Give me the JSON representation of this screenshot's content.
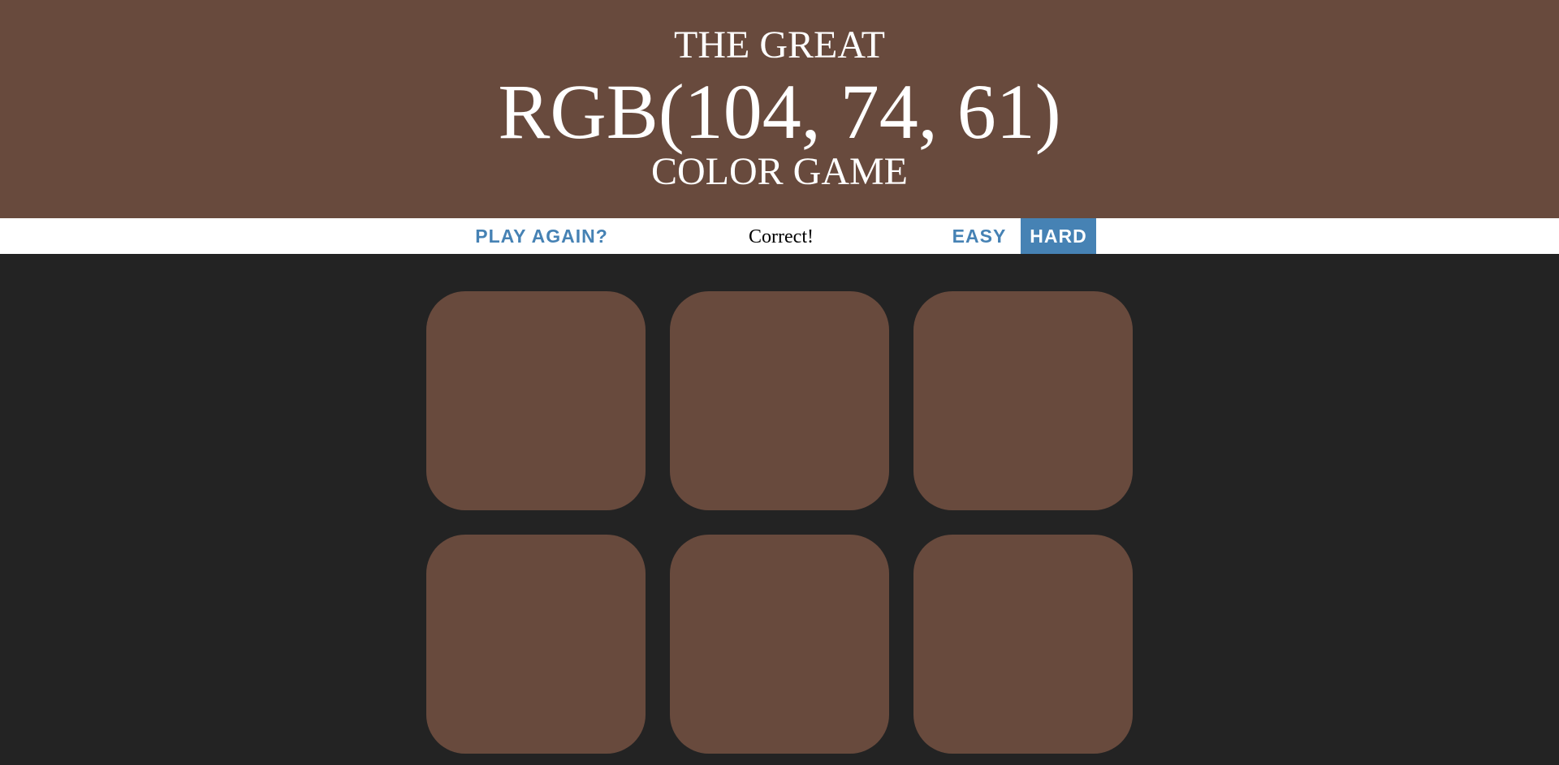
{
  "header": {
    "line1": "THE GREAT",
    "rgb_display": "RGB(104, 74, 61)",
    "line3": "COLOR GAME",
    "background_color": "#684a3d"
  },
  "controls": {
    "reset_label": "PLAY AGAIN?",
    "message": "Correct!",
    "easy_label": "EASY",
    "hard_label": "HARD",
    "selected_mode": "HARD",
    "accent_color": "#4682b4"
  },
  "squares": [
    {
      "color": "#684a3d"
    },
    {
      "color": "#684a3d"
    },
    {
      "color": "#684a3d"
    },
    {
      "color": "#684a3d"
    },
    {
      "color": "#684a3d"
    },
    {
      "color": "#684a3d"
    }
  ],
  "colors": {
    "page_background": "#232323",
    "stripe_background": "#ffffff"
  }
}
